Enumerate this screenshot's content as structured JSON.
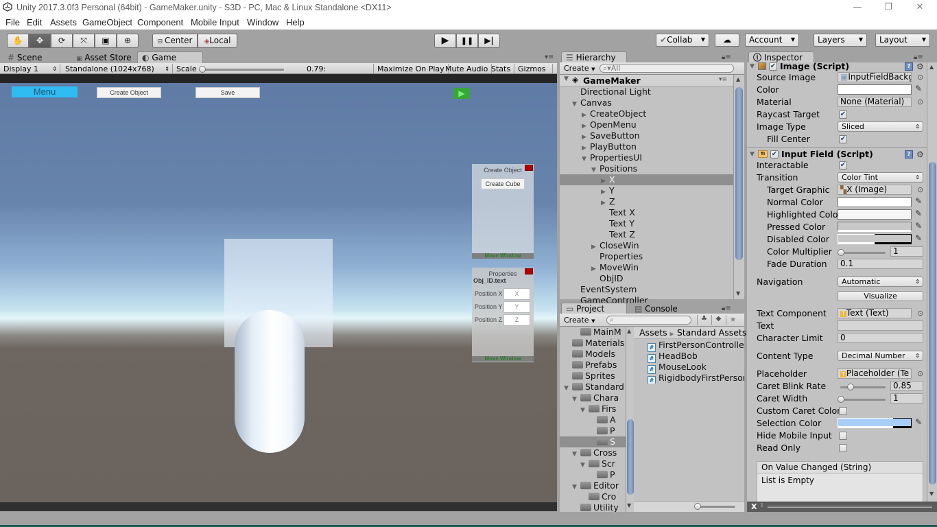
{
  "window": {
    "title": "Unity 2017.3.0f3 Personal (64bit) - GameMaker.unity - S3D - PC, Mac & Linux Standalone <DX11>",
    "controls": {
      "minimize": "—",
      "restore": "❐",
      "close": "✕"
    }
  },
  "menu": [
    "File",
    "Edit",
    "Assets",
    "GameObject",
    "Component",
    "Mobile Input",
    "Window",
    "Help"
  ],
  "toolbar": {
    "tools": [
      {
        "name": "hand-tool",
        "glyph": "✋"
      },
      {
        "name": "move-tool",
        "glyph": "✥"
      },
      {
        "name": "rotate-tool",
        "glyph": "⟳"
      },
      {
        "name": "scale-tool",
        "glyph": "⤧"
      },
      {
        "name": "rect-tool",
        "glyph": "▣"
      },
      {
        "name": "transform-tool",
        "glyph": "⊕"
      }
    ],
    "pivot": "Center",
    "space": "Local",
    "play": "▶",
    "pause": "❚❚",
    "step": "▶|",
    "collab": "Collab",
    "cloud": "☁",
    "account": "Account",
    "layers": "Layers",
    "layout": "Layout"
  },
  "scene_tabs": [
    {
      "label": "Scene",
      "icon": "#"
    },
    {
      "label": "Asset Store",
      "icon": "🔒"
    },
    {
      "label": "Game",
      "icon": "◐"
    }
  ],
  "game_bar": {
    "display": "Display 1",
    "resolution": "Standalone (1024x768)",
    "scale_label": "Scale",
    "scale_value": "0.79:",
    "maximize": "Maximize On Play",
    "mute": "Mute Audio",
    "stats": "Stats",
    "gizmos": "Gizmos"
  },
  "game": {
    "menu_button": "Menu",
    "create_object_button": "Create Object",
    "save_button": "Save",
    "play_glyph": "▶",
    "create_panel": {
      "title": "Create Object",
      "button": "Create Cube",
      "move": "Move Window"
    },
    "properties_panel": {
      "title": "Properties",
      "obj_id": "Obj_ID.text",
      "rows": [
        {
          "label": "Position X",
          "placeholder": "X"
        },
        {
          "label": "Position Y",
          "placeholder": "Y"
        },
        {
          "label": "Position Z",
          "placeholder": "Z"
        }
      ],
      "move": "Move Window"
    }
  },
  "hierarchy": {
    "tab": "Hierarchy",
    "create": "Create",
    "search_placeholder": "All",
    "scene": "GameMaker",
    "items": [
      {
        "label": "Directional Light",
        "depth": 1,
        "arrow": ""
      },
      {
        "label": "Canvas",
        "depth": 1,
        "arrow": "▼"
      },
      {
        "label": "CreateObject",
        "depth": 2,
        "arrow": "▶"
      },
      {
        "label": "OpenMenu",
        "depth": 2,
        "arrow": "▶"
      },
      {
        "label": "SaveButton",
        "depth": 2,
        "arrow": "▶"
      },
      {
        "label": "PlayButton",
        "depth": 2,
        "arrow": "▶"
      },
      {
        "label": "PropertiesUI",
        "depth": 2,
        "arrow": "▼"
      },
      {
        "label": "Positions",
        "depth": 3,
        "arrow": "▼"
      },
      {
        "label": "X",
        "depth": 4,
        "arrow": "▶",
        "selected": true
      },
      {
        "label": "Y",
        "depth": 4,
        "arrow": "▶"
      },
      {
        "label": "Z",
        "depth": 4,
        "arrow": "▶"
      },
      {
        "label": "Text X",
        "depth": 4,
        "arrow": ""
      },
      {
        "label": "Text Y",
        "depth": 4,
        "arrow": ""
      },
      {
        "label": "Text Z",
        "depth": 4,
        "arrow": ""
      },
      {
        "label": "CloseWin",
        "depth": 3,
        "arrow": "▶"
      },
      {
        "label": "Properties",
        "depth": 3,
        "arrow": ""
      },
      {
        "label": "MoveWin",
        "depth": 3,
        "arrow": "▶"
      },
      {
        "label": "ObjID",
        "depth": 3,
        "arrow": ""
      },
      {
        "label": "EventSystem",
        "depth": 1,
        "arrow": ""
      },
      {
        "label": "GameController",
        "depth": 1,
        "arrow": ""
      }
    ]
  },
  "project": {
    "tabs": [
      "Project",
      "Console"
    ],
    "create": "Create",
    "search_placeholder": "",
    "tree": [
      {
        "label": "MainM",
        "depth": 2,
        "arrow": ""
      },
      {
        "label": "Materials",
        "depth": 1,
        "arrow": ""
      },
      {
        "label": "Models",
        "depth": 1,
        "arrow": ""
      },
      {
        "label": "Prefabs",
        "depth": 1,
        "arrow": ""
      },
      {
        "label": "Sprites",
        "depth": 1,
        "arrow": ""
      },
      {
        "label": "Standard",
        "depth": 1,
        "arrow": "▼"
      },
      {
        "label": "Chara",
        "depth": 2,
        "arrow": "▼"
      },
      {
        "label": "Firs",
        "depth": 3,
        "arrow": "▼"
      },
      {
        "label": "A",
        "depth": 4,
        "arrow": ""
      },
      {
        "label": "P",
        "depth": 4,
        "arrow": ""
      },
      {
        "label": "S",
        "depth": 4,
        "arrow": "",
        "selected": true
      },
      {
        "label": "Cross",
        "depth": 2,
        "arrow": "▼"
      },
      {
        "label": "Scr",
        "depth": 3,
        "arrow": "▼"
      },
      {
        "label": "P",
        "depth": 4,
        "arrow": ""
      },
      {
        "label": "Editor",
        "depth": 2,
        "arrow": "▼"
      },
      {
        "label": "Cro",
        "depth": 3,
        "arrow": ""
      },
      {
        "label": "Utility",
        "depth": 2,
        "arrow": ""
      }
    ],
    "breadcrumb": [
      "Assets",
      "Standard Assets"
    ],
    "files": [
      "FirstPersonController",
      "HeadBob",
      "MouseLook",
      "RigidbodyFirstPersonC"
    ],
    "zoom_slider": 0.0
  },
  "inspector": {
    "tab": "Inspector",
    "image": {
      "title": "Image (Script)",
      "enabled": true,
      "source_image_label": "Source Image",
      "source_image": "InputFieldBackg",
      "color_label": "Color",
      "color": "#ffffff",
      "material_label": "Material",
      "material": "None (Material)",
      "raycast_label": "Raycast Target",
      "raycast": true,
      "image_type_label": "Image Type",
      "image_type": "Sliced",
      "fill_center_label": "Fill Center",
      "fill_center": true
    },
    "input_field": {
      "title": "Input Field (Script)",
      "enabled": true,
      "interactable_label": "Interactable",
      "interactable": true,
      "transition_label": "Transition",
      "transition": "Color Tint",
      "target_graphic_label": "Target Graphic",
      "target_graphic": "X (Image)",
      "normal_color_label": "Normal Color",
      "normal_color": "#ffffff",
      "highlighted_color_label": "Highlighted Color",
      "highlighted_color": "#f5f5f5",
      "pressed_color_label": "Pressed Color",
      "pressed_color": "#c8c8c8",
      "disabled_color_label": "Disabled Color",
      "disabled_color": "#c8c8c8",
      "color_multiplier_label": "Color Multiplier",
      "color_multiplier": "1",
      "color_multiplier_fraction": 0.0,
      "fade_duration_label": "Fade Duration",
      "fade_duration": "0.1",
      "navigation_label": "Navigation",
      "navigation": "Automatic",
      "visualize": "Visualize",
      "text_component_label": "Text Component",
      "text_component": "Text (Text)",
      "text_label": "Text",
      "text": "",
      "char_limit_label": "Character Limit",
      "char_limit": "0",
      "content_type_label": "Content Type",
      "content_type": "Decimal Number",
      "placeholder_label": "Placeholder",
      "placeholder": "Placeholder (Te",
      "caret_blink_label": "Caret Blink Rate",
      "caret_blink": "0.85",
      "caret_blink_fraction": 0.2125,
      "caret_width_label": "Caret Width",
      "caret_width": "1",
      "caret_width_fraction": 0.0,
      "custom_caret_label": "Custom Caret Color",
      "custom_caret": false,
      "selection_color_label": "Selection Color",
      "selection_color": "#a8cef8",
      "hide_mobile_label": "Hide Mobile Input",
      "hide_mobile": false,
      "read_only_label": "Read Only",
      "read_only": false,
      "event_title": "On Value Changed (String)",
      "event_body": "List is Empty"
    },
    "footer_label": "X"
  }
}
